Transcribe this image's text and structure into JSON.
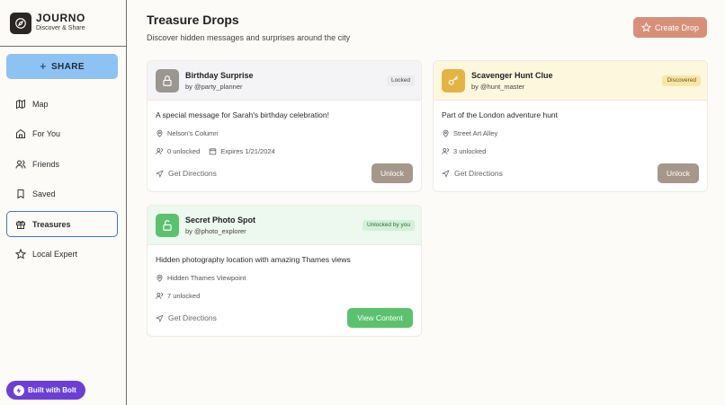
{
  "brand": {
    "title": "JOURNO",
    "subtitle": "Discover & Share",
    "icon": "compass-icon"
  },
  "sidebar": {
    "share_label": "SHARE",
    "items": [
      {
        "label": "Map",
        "icon": "map-icon",
        "active": false
      },
      {
        "label": "For You",
        "icon": "home-icon",
        "active": false
      },
      {
        "label": "Friends",
        "icon": "users-icon",
        "active": false
      },
      {
        "label": "Saved",
        "icon": "bookmark-icon",
        "active": false
      },
      {
        "label": "Treasures",
        "icon": "gift-icon",
        "active": true
      },
      {
        "label": "Local Expert",
        "icon": "star-icon",
        "active": false
      }
    ],
    "built_with": "Built with Bolt"
  },
  "header": {
    "title": "Treasure Drops",
    "subtitle": "Discover hidden messages and surprises around the city",
    "create_label": "Create Drop"
  },
  "colors": {
    "accent_blue": "#8ec2f3",
    "create_button": "#d6907a",
    "locked_gray": "#9a9690",
    "discovered_yellow": "#e3b443",
    "unlocked_green": "#5cc16e",
    "bolt_purple": "#6b3fd6"
  },
  "cards": [
    {
      "title": "Birthday Surprise",
      "author": "by @party_planner",
      "status": "Locked",
      "description": "A special message for Sarah's birthday celebration!",
      "location": "Nelson's Column",
      "unlocked": "0 unlocked",
      "expires": "Expires 1/21/2024",
      "directions": "Get Directions",
      "action": "Unlock"
    },
    {
      "title": "Scavenger Hunt Clue",
      "author": "by @hunt_master",
      "status": "Discovered",
      "description": "Part of the London adventure hunt",
      "location": "Street Art Alley",
      "unlocked": "3 unlocked",
      "directions": "Get Directions",
      "action": "Unlock"
    },
    {
      "title": "Secret Photo Spot",
      "author": "by @photo_explorer",
      "status": "Unlocked by you",
      "description": "Hidden photography location with amazing Thames views",
      "location": "Hidden Thames Viewpoint",
      "unlocked": "7 unlocked",
      "directions": "Get Directions",
      "action": "View Content"
    }
  ]
}
